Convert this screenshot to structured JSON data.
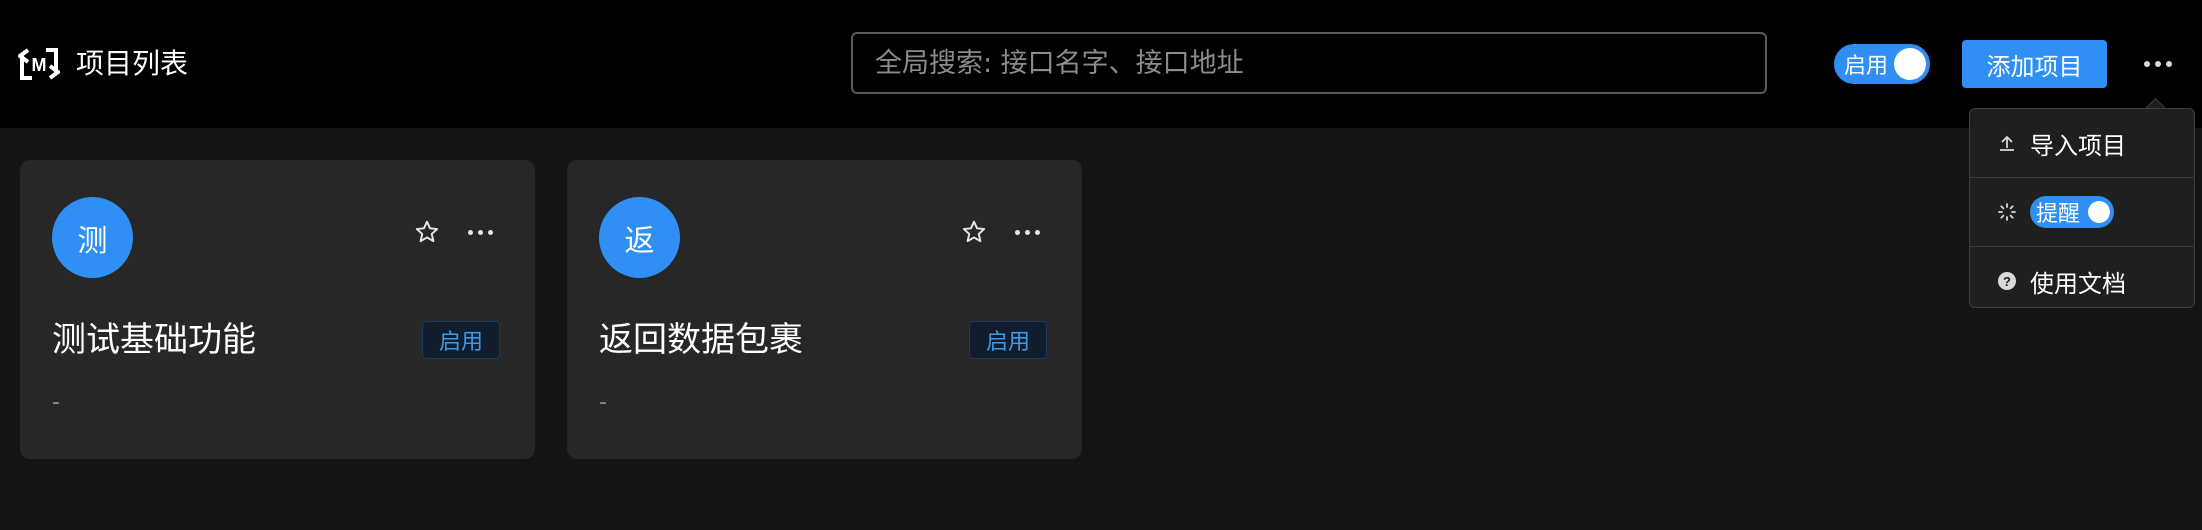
{
  "header": {
    "title": "项目列表",
    "logo_icon": "m-logo-icon",
    "search": {
      "placeholder": "全局搜索: 接口名字、接口地址",
      "value": ""
    },
    "toggle_label": "启用",
    "toggle_on": true,
    "add_button_label": "添加项目",
    "more_icon": "ellipsis-icon"
  },
  "dropdown": {
    "items": [
      {
        "label": "导入项目",
        "icon": "upload-icon"
      },
      {
        "label": "提醒",
        "icon": "loading-icon",
        "toggle_on": true
      },
      {
        "label": "使用文档",
        "icon": "question-circle-icon"
      }
    ]
  },
  "cards": [
    {
      "avatar": "测",
      "title": "测试基础功能",
      "status": "启用",
      "description": "-"
    },
    {
      "avatar": "返",
      "title": "返回数据包裹",
      "status": "启用",
      "description": "-"
    }
  ],
  "colors": {
    "accent": "#2f8ff4",
    "header_bg": "#000000",
    "page_bg": "#141414",
    "card_bg": "#272727"
  }
}
